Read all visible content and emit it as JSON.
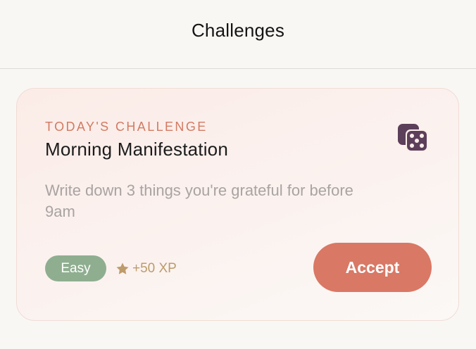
{
  "header": {
    "title": "Challenges"
  },
  "challenge": {
    "eyebrow": "TODAY'S CHALLENGE",
    "title": "Morning Manifestation",
    "description": "Write down 3 things you're grateful for before 9am",
    "difficulty": "Easy",
    "reward": "+50 XP",
    "reward_icon": "star-icon",
    "shuffle_icon": "dice-icon",
    "accept_label": "Accept"
  },
  "colors": {
    "accent": "#d97865",
    "eyebrow": "#d37a62",
    "easy_badge": "#8fae90",
    "xp_gold": "#bd9b6a",
    "dice": "#5c3f5b"
  }
}
